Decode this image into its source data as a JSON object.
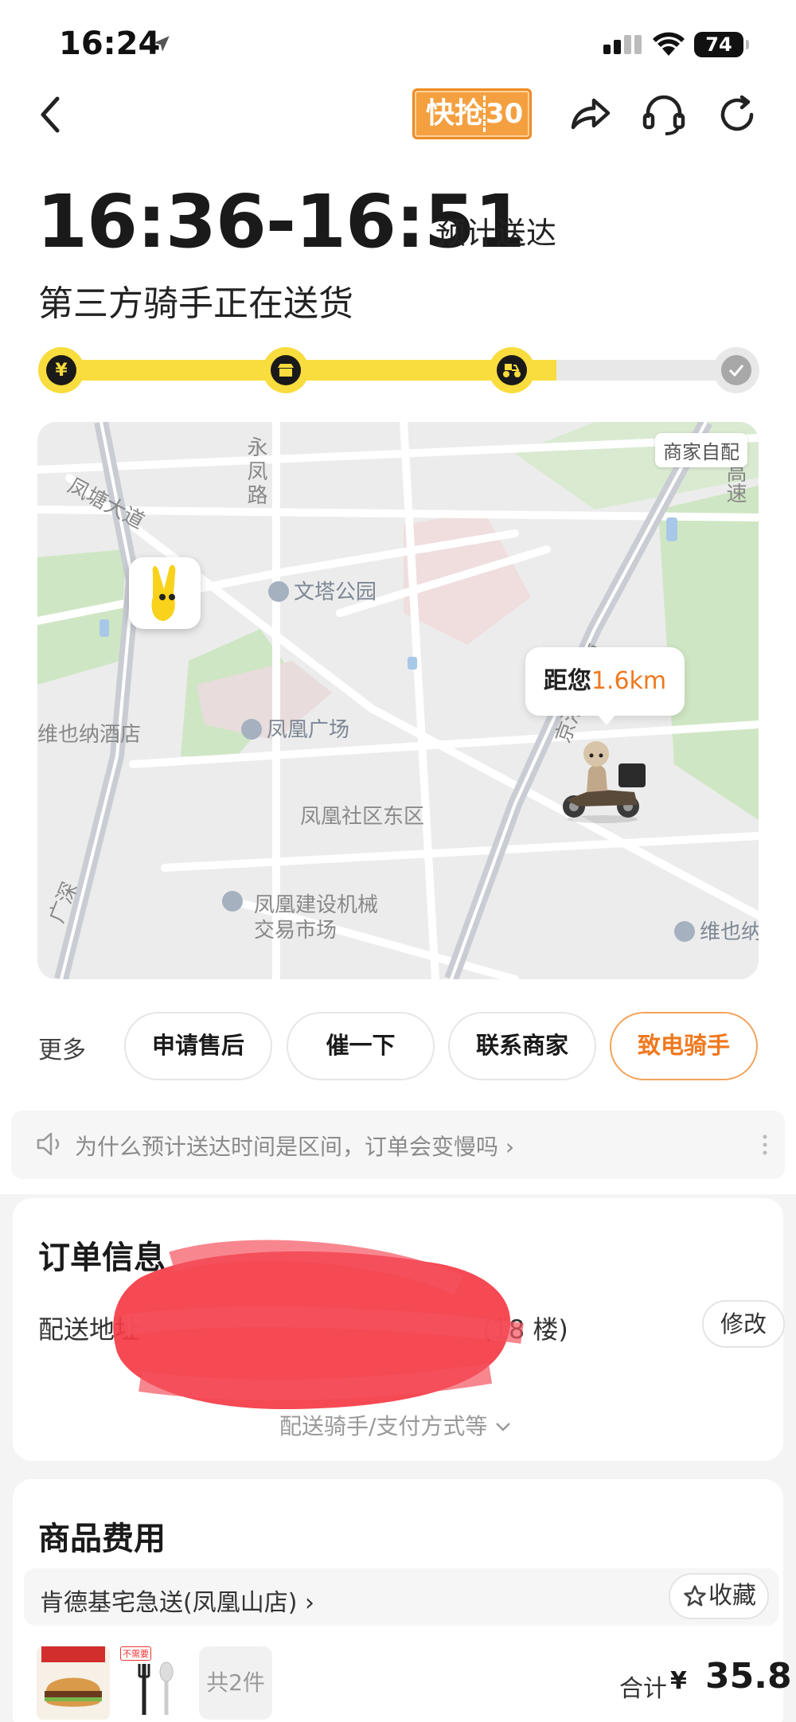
{
  "status_bar": {
    "time": "16:24",
    "battery": "74"
  },
  "header": {
    "promo_badge_text": "快抢",
    "promo_badge_num": "30",
    "icons": [
      "back-icon",
      "share-icon",
      "customer-service-icon",
      "refresh-icon"
    ]
  },
  "delivery": {
    "eta": "16:36-16:51",
    "eta_label": "预计送达",
    "status": "第三方骑手正在送货",
    "progress_steps": [
      "paid",
      "merchant",
      "delivering",
      "done"
    ],
    "progress_fraction": 0.72
  },
  "map": {
    "self_pickup_label": "商家自配",
    "distance_prefix": "距您",
    "distance_value": "1.6km",
    "labels": {
      "road_fengtang": "凤塘大道",
      "road_yongfeng": "永凤路",
      "wenta_park": "文塔公园",
      "vienna_hotel": "维也纳酒店",
      "fenghuang_square": "凤凰广场",
      "fenghuang_east": "凤凰社区东区",
      "jinggang_highway": "京港澳高速",
      "machinery_market": "凤凰建设机械",
      "machinery_market2": "交易市场",
      "guangshen": "广深",
      "vienna_right": "维也纳",
      "highway_top": "高速"
    }
  },
  "actions": {
    "more_label": "更多",
    "buttons": [
      "申请售后",
      "催一下",
      "联系商家",
      "致电骑手"
    ]
  },
  "notice": {
    "text": "为什么预计送达时间是区间，订单会变慢吗 ›"
  },
  "order_info": {
    "title": "订单信息",
    "address_label": "配送地址",
    "address_tail": "(18 楼)",
    "edit_label": "修改",
    "expand_label": "配送骑手/支付方式等"
  },
  "goods": {
    "title": "商品费用",
    "shop_name": "肯德基宅急送(凤凰山店)",
    "favorite_label": "收藏",
    "cutlery_tag": "不需要",
    "item_count": "共2件",
    "total_label": "合计",
    "currency": "¥",
    "total": "35.8"
  },
  "colors": {
    "accent_yellow": "#f9dc3d",
    "accent_orange": "#f0781e"
  }
}
